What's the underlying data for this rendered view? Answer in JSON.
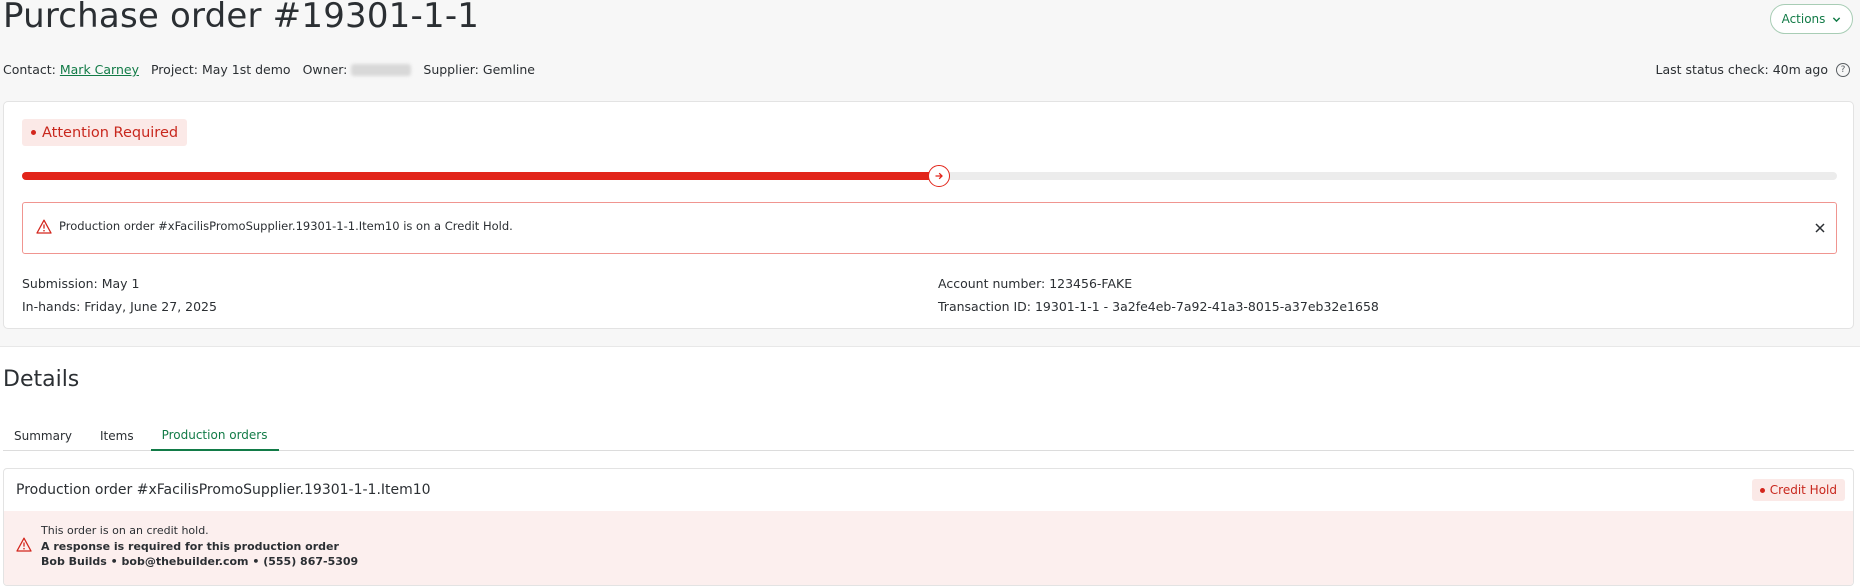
{
  "header": {
    "title": "Purchase order #19301-1-1",
    "actions_label": "Actions",
    "contact_label": "Contact:",
    "contact_name": "Mark Carney",
    "project_label": "Project:",
    "project_value": "May 1st demo",
    "owner_label": "Owner:",
    "supplier_label": "Supplier:",
    "supplier_value": "Gemline",
    "last_status": "Last status check: 40m ago"
  },
  "status": {
    "badge": "Attention Required",
    "progress": 0.505,
    "colors": {
      "accent": "#127b47",
      "danger": "#e2251a"
    },
    "alert_text": "Production order #xFacilisPromoSupplier.19301-1-1.Item10 is on a Credit Hold.",
    "submission": "Submission: May 1",
    "in_hands": "In-hands: Friday, June 27, 2025",
    "account_number": "Account number: 123456-FAKE",
    "transaction_id": "Transaction ID: 19301-1-1 - 3a2fe4eb-7a92-41a3-8015-a37eb32e1658"
  },
  "details": {
    "title": "Details",
    "tabs": [
      {
        "label": "Summary",
        "active": false
      },
      {
        "label": "Items",
        "active": false
      },
      {
        "label": "Production orders",
        "active": true
      }
    ]
  },
  "production_order": {
    "title": "Production order #xFacilisPromoSupplier.19301-1-1.Item10",
    "badge": "Credit Hold",
    "line1": "This order is on an credit hold.",
    "line2": "A response is required for this production order",
    "line3": "Bob Builds • bob@thebuilder.com • (555) 867-5309"
  }
}
